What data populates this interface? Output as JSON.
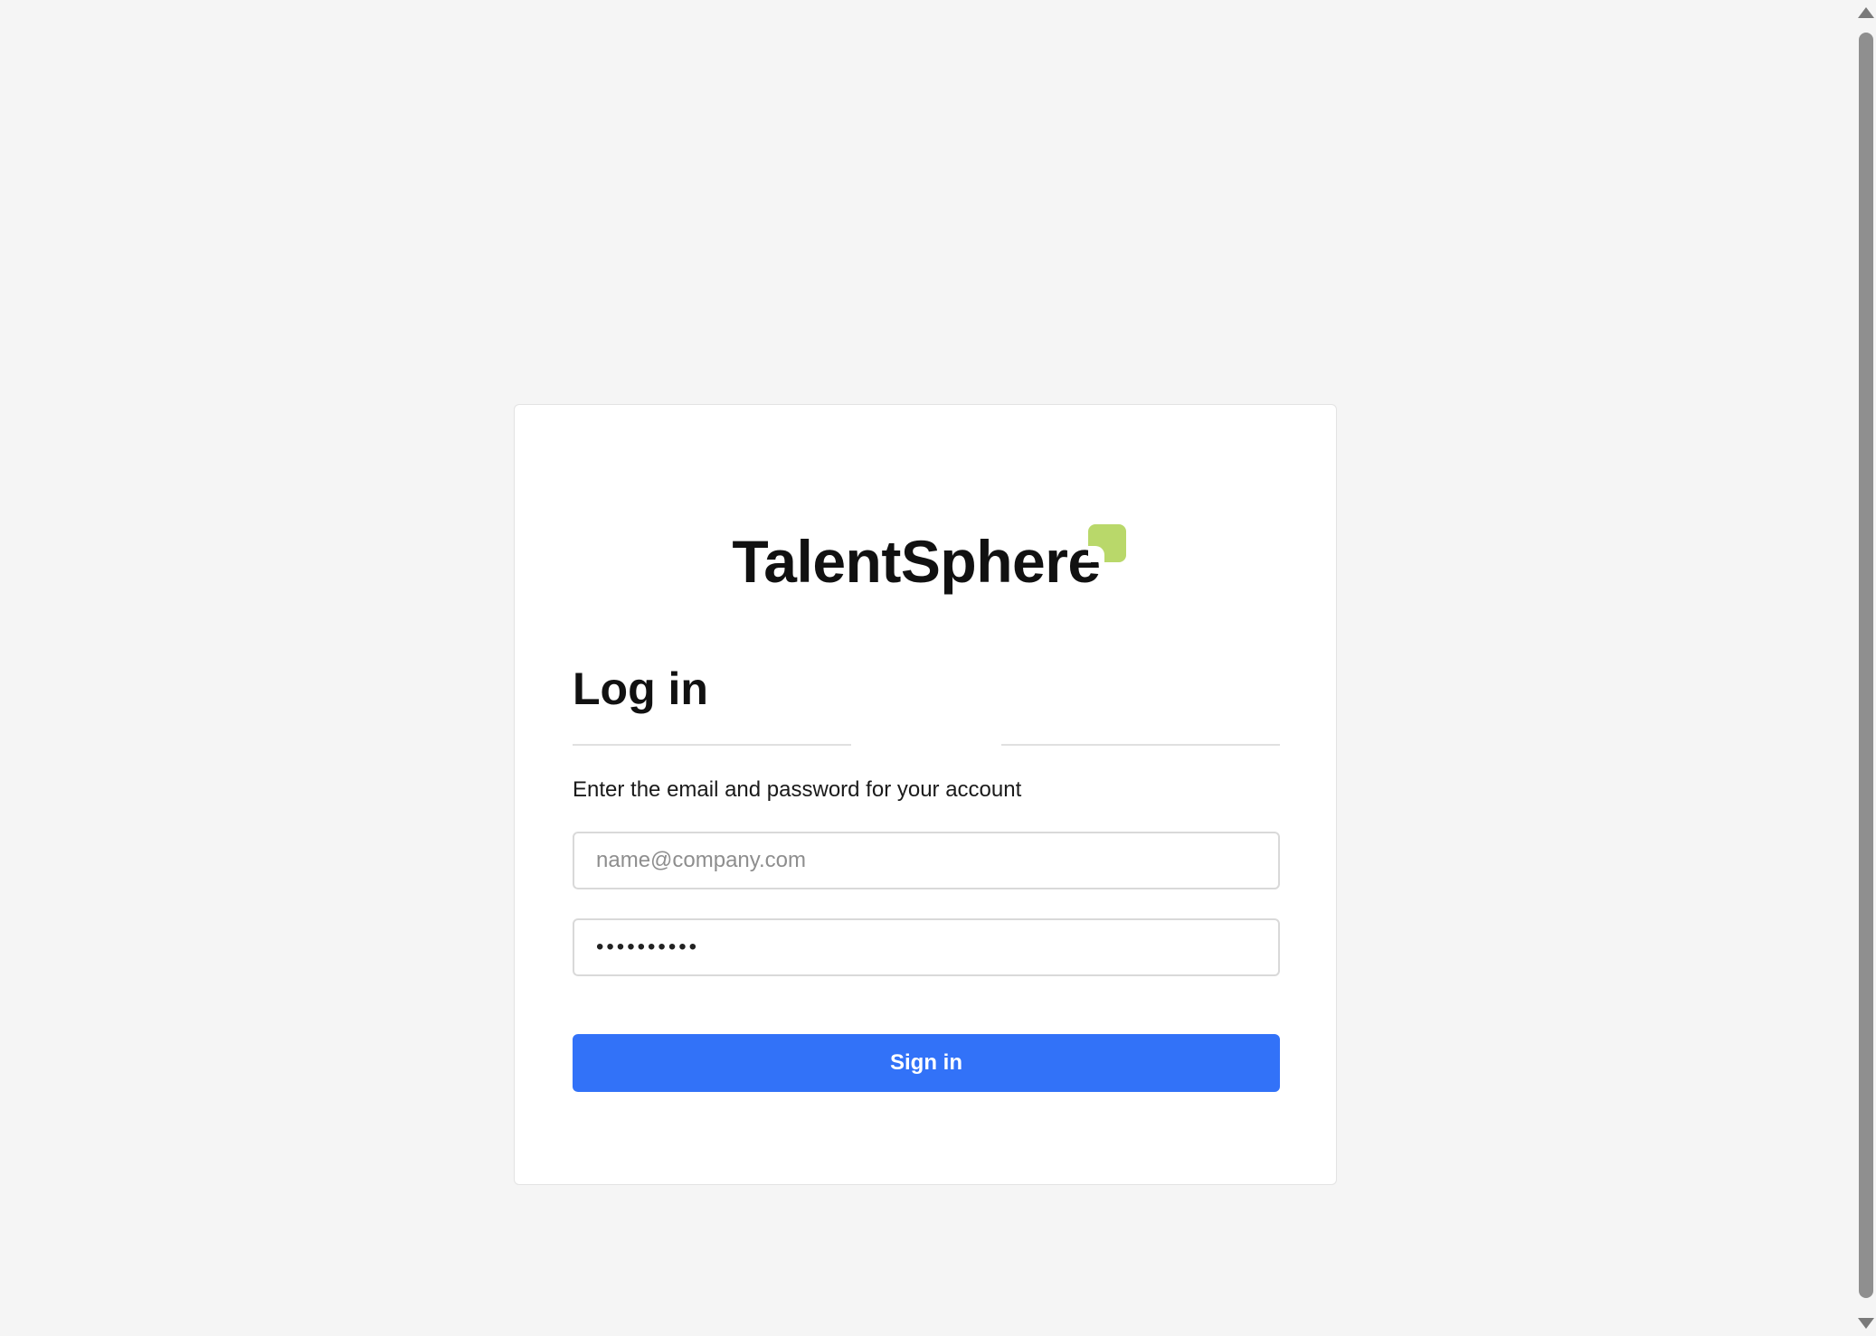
{
  "brand": {
    "name": "TalentSphere",
    "accent_color": "#b9d86a"
  },
  "login": {
    "title": "Log in",
    "subtitle": "Enter the email and password for your account",
    "email_placeholder": "name@company.com",
    "password_value": "••••••••••",
    "submit_label": "Sign in",
    "submit_color": "#3272f8"
  },
  "icons": {
    "scroll_up": "triangle-up",
    "scroll_down": "triangle-down"
  }
}
